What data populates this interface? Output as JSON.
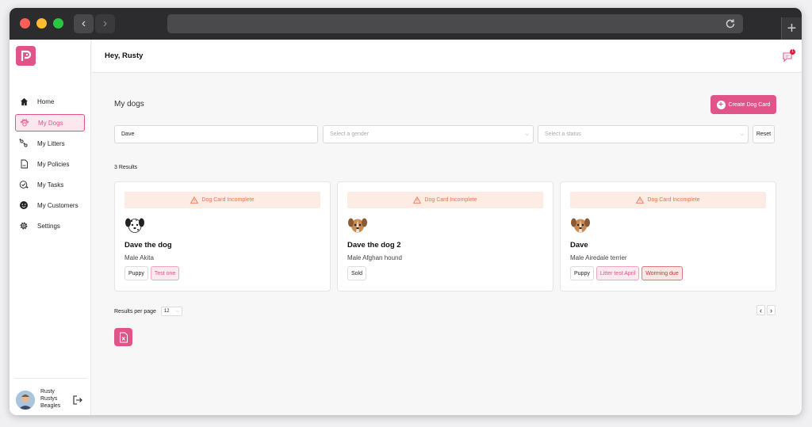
{
  "header": {
    "greeting": "Hey, Rusty",
    "notification_count": "1"
  },
  "sidebar": {
    "items": [
      {
        "label": "Home",
        "icon": "home-icon"
      },
      {
        "label": "My Dogs",
        "icon": "paw-icon",
        "active": true
      },
      {
        "label": "My Litters",
        "icon": "paws-icon"
      },
      {
        "label": "My Policies",
        "icon": "document-icon"
      },
      {
        "label": "My Tasks",
        "icon": "task-check-icon"
      },
      {
        "label": "My Customers",
        "icon": "customers-icon"
      },
      {
        "label": "Settings",
        "icon": "gear-icon"
      }
    ],
    "user": {
      "name_line1": "Rusty",
      "name_line2": "Rustys",
      "name_line3": "Beagles"
    }
  },
  "main": {
    "title": "My dogs",
    "create_button": "Create Dog Card",
    "filters": {
      "search_value": "Dave",
      "gender_placeholder": "Select a gender",
      "status_placeholder": "Select a status",
      "reset_label": "Reset"
    },
    "results_text": "3 Results",
    "cards": [
      {
        "warning": "Dog Card Incomplete",
        "name": "Dave the dog",
        "desc": "Male Akita",
        "tags": [
          "Puppy",
          "Test one"
        ],
        "icon": "dalmatian-dog-icon"
      },
      {
        "warning": "Dog Card Incomplete",
        "name": "Dave the dog 2",
        "desc": "Male Afghan hound",
        "tags": [
          "Sold"
        ],
        "icon": "brown-dog-icon"
      },
      {
        "warning": "Dog Card Incomplete",
        "name": "Dave",
        "desc": "Male Airedale terrier",
        "tags": [
          "Puppy",
          "Litter test April",
          "Worming due"
        ],
        "icon": "brown-dog-icon"
      }
    ],
    "pagination": {
      "label": "Results per page",
      "per_page": "12",
      "prev": "‹",
      "next": "›"
    }
  },
  "colors": {
    "accent": "#e0548a",
    "warning_text": "#e9734f",
    "warning_bg": "#fdece4"
  }
}
